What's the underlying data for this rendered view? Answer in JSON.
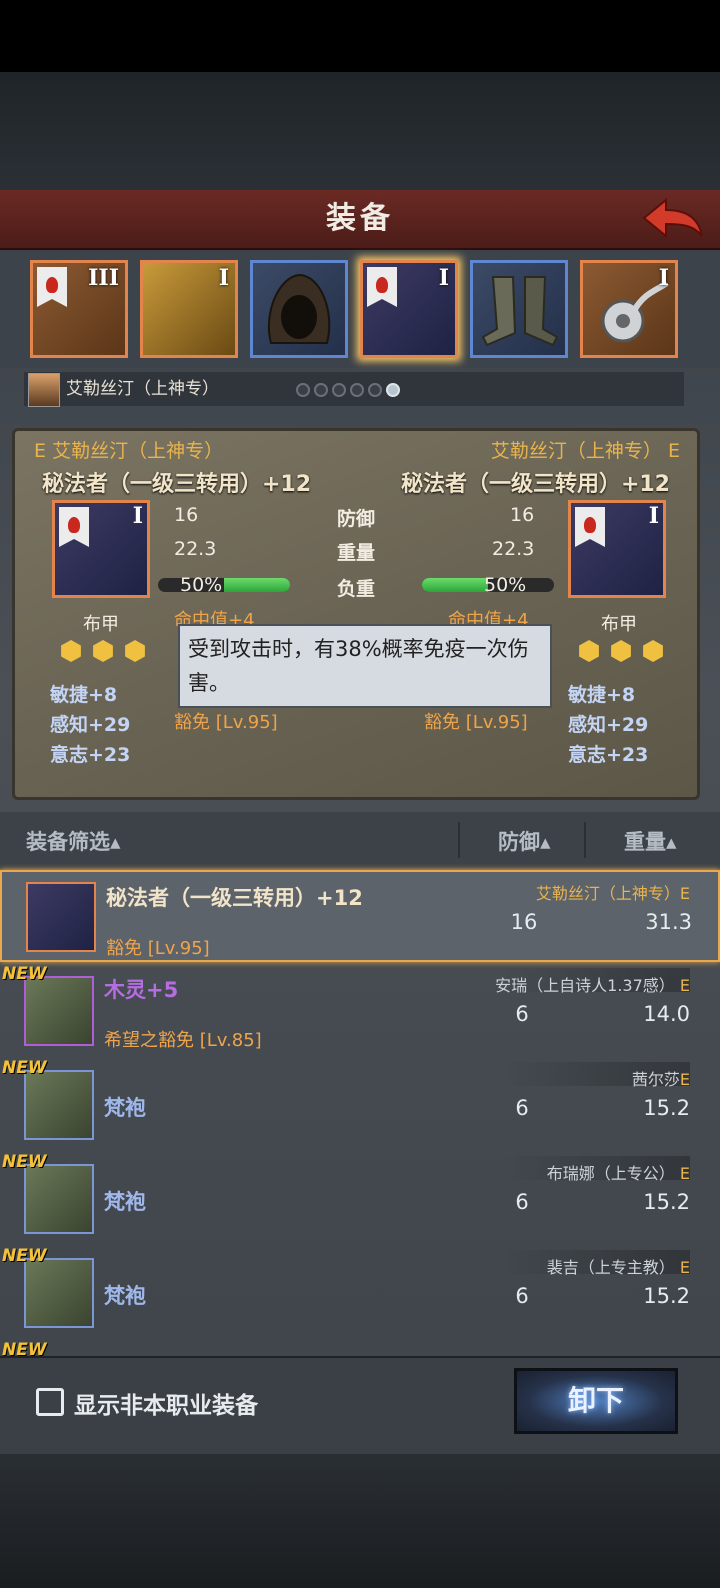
{
  "header": {
    "title": "装备"
  },
  "slots": [
    {
      "roman": "III",
      "name": "helmet"
    },
    {
      "roman": "I",
      "name": "accessory"
    },
    {
      "roman": "",
      "name": "hood"
    },
    {
      "roman": "I",
      "name": "armor"
    },
    {
      "roman": "",
      "name": "boots"
    },
    {
      "roman": "I",
      "name": "charm"
    }
  ],
  "character": {
    "name": "艾勒丝汀（上神专）"
  },
  "compare": {
    "left": {
      "grade": "E",
      "owner": "艾勒丝汀（上神专）",
      "item": "秘法者（一级三转用）+12",
      "roman": "I",
      "defense": "16",
      "weight": "22.3",
      "load": "50%",
      "load_fraction": 0.5,
      "hit": "命中值+4",
      "armor_type": "布甲",
      "attrs": [
        "敏捷+8",
        "感知+29",
        "意志+23"
      ],
      "skill": "豁免 [Lv.95]"
    },
    "right": {
      "grade": "E",
      "owner": "艾勒丝汀（上神专）",
      "item": "秘法者（一级三转用）+12",
      "roman": "I",
      "defense": "16",
      "weight": "22.3",
      "load": "50%",
      "load_fraction": 0.5,
      "hit": "命中值+4",
      "armor_type": "布甲",
      "attrs": [
        "敏捷+8",
        "感知+29",
        "意志+23"
      ],
      "skill": "豁免 [Lv.95]"
    },
    "labels": {
      "defense": "防御",
      "weight": "重量",
      "load": "负重"
    },
    "tooltip": "受到攻击时，有38%概率免疫一次伤害。"
  },
  "filter": {
    "label": "装备筛选▴",
    "defense": "防御▴",
    "weight": "重量▴"
  },
  "list": [
    {
      "new": "",
      "name": "秘法者（一级三转用）+12",
      "owner": "艾勒丝汀（上神专）",
      "grade": "E",
      "def": "16",
      "wt": "31.3",
      "sub": "豁免 [Lv.95]"
    },
    {
      "new": "NEW",
      "name": "木灵+5",
      "owner": "安瑞（上自诗人1.37感）",
      "grade": "E",
      "def": "6",
      "wt": "14.0",
      "sub": "希望之豁免 [Lv.85]"
    },
    {
      "new": "NEW",
      "name": "梵袍",
      "owner": "茜尔莎",
      "grade": "E",
      "def": "6",
      "wt": "15.2",
      "sub": ""
    },
    {
      "new": "NEW",
      "name": "梵袍",
      "owner": "布瑞娜（上专公）",
      "grade": "E",
      "def": "6",
      "wt": "15.2",
      "sub": ""
    },
    {
      "new": "NEW",
      "name": "梵袍",
      "owner": "裴吉（上专主教）",
      "grade": "E",
      "def": "6",
      "wt": "15.2",
      "sub": ""
    },
    {
      "new": "NEW",
      "name": "",
      "owner": "",
      "grade": "",
      "def": "",
      "wt": "",
      "sub": ""
    }
  ],
  "bottom": {
    "checkbox_label": "显示非本职业装备",
    "unequip": "卸下"
  }
}
